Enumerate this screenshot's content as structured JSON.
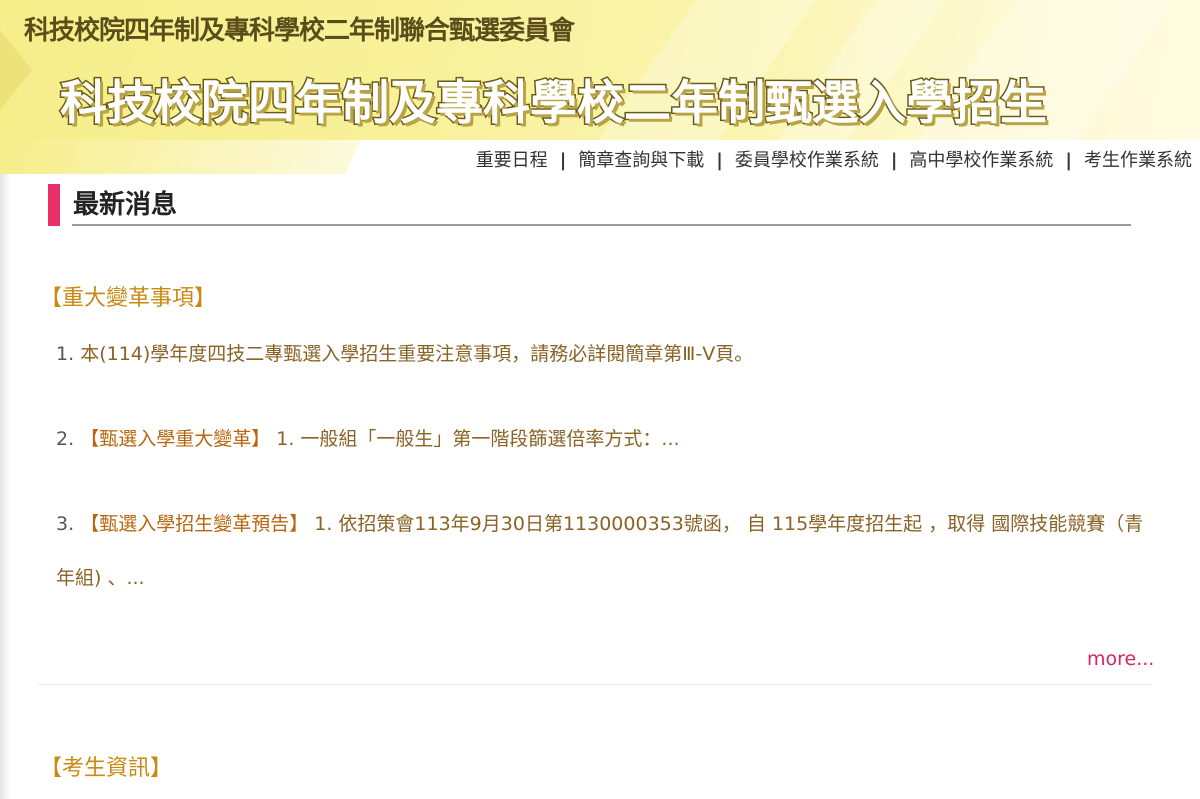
{
  "header": {
    "org_name": "科技校院四年制及專科學校二年制聯合甄選委員會",
    "site_title": "科技校院四年制及專科學校二年制甄選入學招生"
  },
  "nav": {
    "items": [
      {
        "label": "重要日程"
      },
      {
        "label": "簡章查詢與下載"
      },
      {
        "label": "委員學校作業系統"
      },
      {
        "label": "高中學校作業系統"
      },
      {
        "label": "考生作業系統"
      }
    ],
    "separator": "|"
  },
  "news": {
    "section_title": "最新消息",
    "categories": [
      {
        "title": "【重大變革事項】",
        "items": [
          {
            "num": "1.",
            "prefix": "",
            "text": "本(114)學年度四技二專甄選入學招生重要注意事項，請務必詳閱簡章第Ⅲ-Ⅴ頁。"
          },
          {
            "num": "2.",
            "prefix": "【甄選入學重大變革】",
            "text": "1. 一般組「一般生」第一階段篩選倍率方式：..."
          },
          {
            "num": "3.",
            "prefix": "【甄選入學招生變革預告】",
            "text": "1. 依招策會113年9月30日第1130000353號函， 自 115學年度招生起 ，取得 國際技能競賽（青年組) 、..."
          }
        ],
        "more_label": "more..."
      },
      {
        "title": "【考生資訊】"
      }
    ]
  },
  "colors": {
    "accent_bar": "#e8306a",
    "category_title": "#c98a13",
    "item_text": "#8a6326",
    "more_link": "#d6245f",
    "banner_bg": "#f6ee8a"
  }
}
